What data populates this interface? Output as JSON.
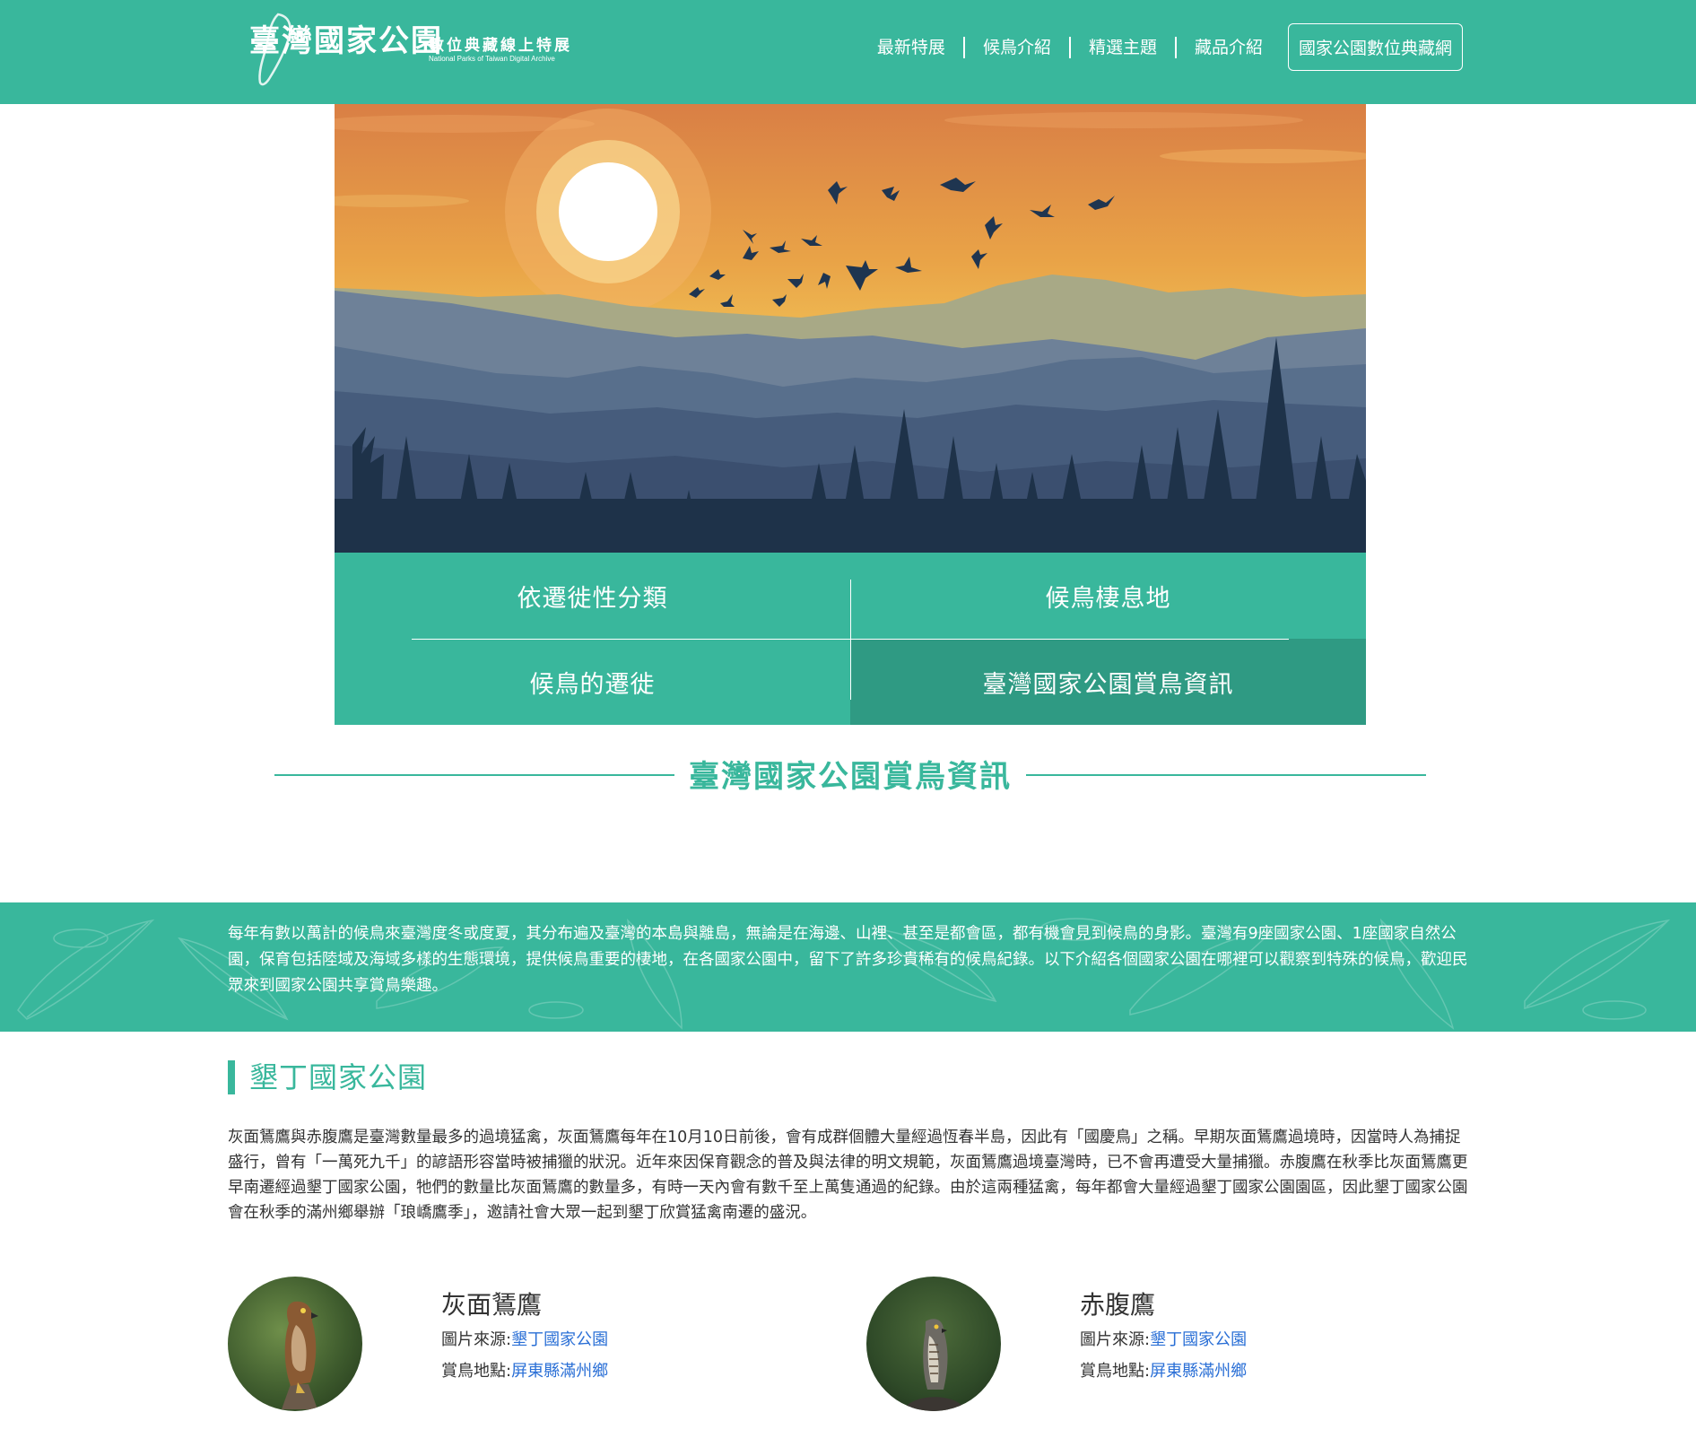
{
  "header": {
    "logo_title": "臺灣國家公園",
    "logo_subtitle": "數位典藏線上特展",
    "logo_en": "National Parks of Taiwan Digital Archive",
    "nav": [
      "最新特展",
      "候鳥介紹",
      "精選主題",
      "藏品介紹"
    ],
    "archive_button": "國家公園數位典藏網"
  },
  "menu": {
    "items": [
      "依遷徙性分類",
      "候鳥棲息地",
      "候鳥的遷徙",
      "臺灣國家公園賞鳥資訊"
    ],
    "active_index": 3
  },
  "section": {
    "title": "臺灣國家公園賞鳥資訊"
  },
  "intro": {
    "text": "每年有數以萬計的候鳥來臺灣度冬或度夏，其分布遍及臺灣的本島與離島，無論是在海邊、山裡、甚至是都會區，都有機會見到候鳥的身影。臺灣有9座國家公園、1座國家自然公園，保育包括陸域及海域多樣的生態環境，提供候鳥重要的棲地，在各國家公園中，留下了許多珍貴稀有的候鳥紀錄。以下介紹各個國家公園在哪裡可以觀察到特殊的候鳥，歡迎民眾來到國家公園共享賞鳥樂趣。"
  },
  "park": {
    "name": "墾丁國家公園",
    "description": "灰面鵟鷹與赤腹鷹是臺灣數量最多的過境猛禽，灰面鵟鷹每年在10月10日前後，會有成群個體大量經過恆春半島，因此有「國慶鳥」之稱。早期灰面鵟鷹過境時，因當時人為捕捉盛行，曾有「一萬死九千」的諺語形容當時被捕獵的狀況。近年來因保育觀念的普及與法律的明文規範，灰面鵟鷹過境臺灣時，已不會再遭受大量捕獵。赤腹鷹在秋季比灰面鵟鷹更早南遷經過墾丁國家公園，牠們的數量比灰面鵟鷹的數量多，有時一天內會有數千至上萬隻通過的紀錄。由於這兩種猛禽，每年都會大量經過墾丁國家公園園區，因此墾丁國家公園會在秋季的滿州鄉舉辦「琅嶠鷹季」，邀請社會大眾一起到墾丁欣賞猛禽南遷的盛況。",
    "birds": [
      {
        "name": "灰面鵟鷹",
        "source_label": "圖片來源:",
        "source_link": "墾丁國家公園",
        "location_label": "賞鳥地點:",
        "location_link": "屏東縣滿州鄉"
      },
      {
        "name": "赤腹鷹",
        "source_label": "圖片來源:",
        "source_link": "墾丁國家公園",
        "location_label": "賞鳥地點:",
        "location_link": "屏東縣滿州鄉"
      }
    ]
  },
  "colors": {
    "primary": "#39b79c",
    "active": "#2f9a83",
    "link": "#2a6fd6"
  }
}
